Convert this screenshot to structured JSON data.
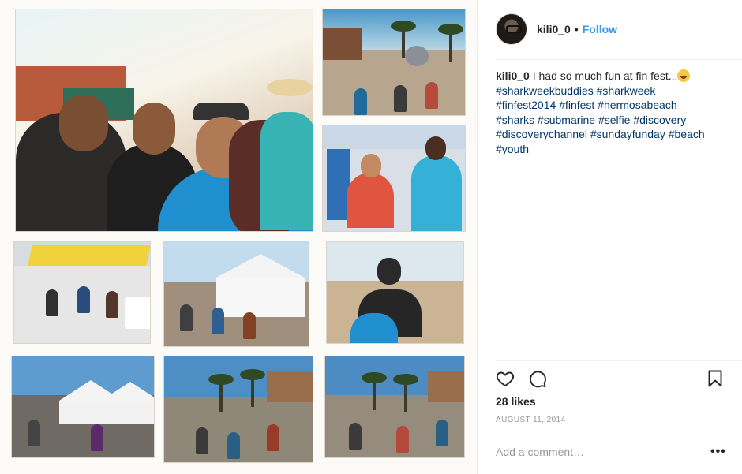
{
  "post": {
    "username": "kili0_0",
    "separator": "•",
    "follow_label": "Follow",
    "caption_user": "kili0_0",
    "caption_text": " I had so much fun at fin fest...",
    "caption_emoji": "grinning-face-emoji",
    "hashtags": [
      "#sharkweekbuddies",
      "#sharkweek",
      "#finfest2014",
      "#finfest",
      "#hermosabeach",
      "#sharks",
      "#submarine",
      "#selfie",
      "#discovery",
      "#discoverychannel",
      "#sundayfunday",
      "#beach",
      "#youth"
    ],
    "likes": "28 likes",
    "date": "AUGUST 11, 2014",
    "comment_placeholder": "Add a comment…",
    "more_label": "•••"
  },
  "icons": {
    "like": "heart-icon",
    "comment": "comment-icon",
    "save": "bookmark-icon",
    "more": "more-options-icon"
  },
  "colors": {
    "link_blue": "#3897f0",
    "hashtag_blue": "#003569",
    "text": "#262626",
    "muted": "#999999"
  },
  "photo": {
    "description_tiles": 10
  }
}
